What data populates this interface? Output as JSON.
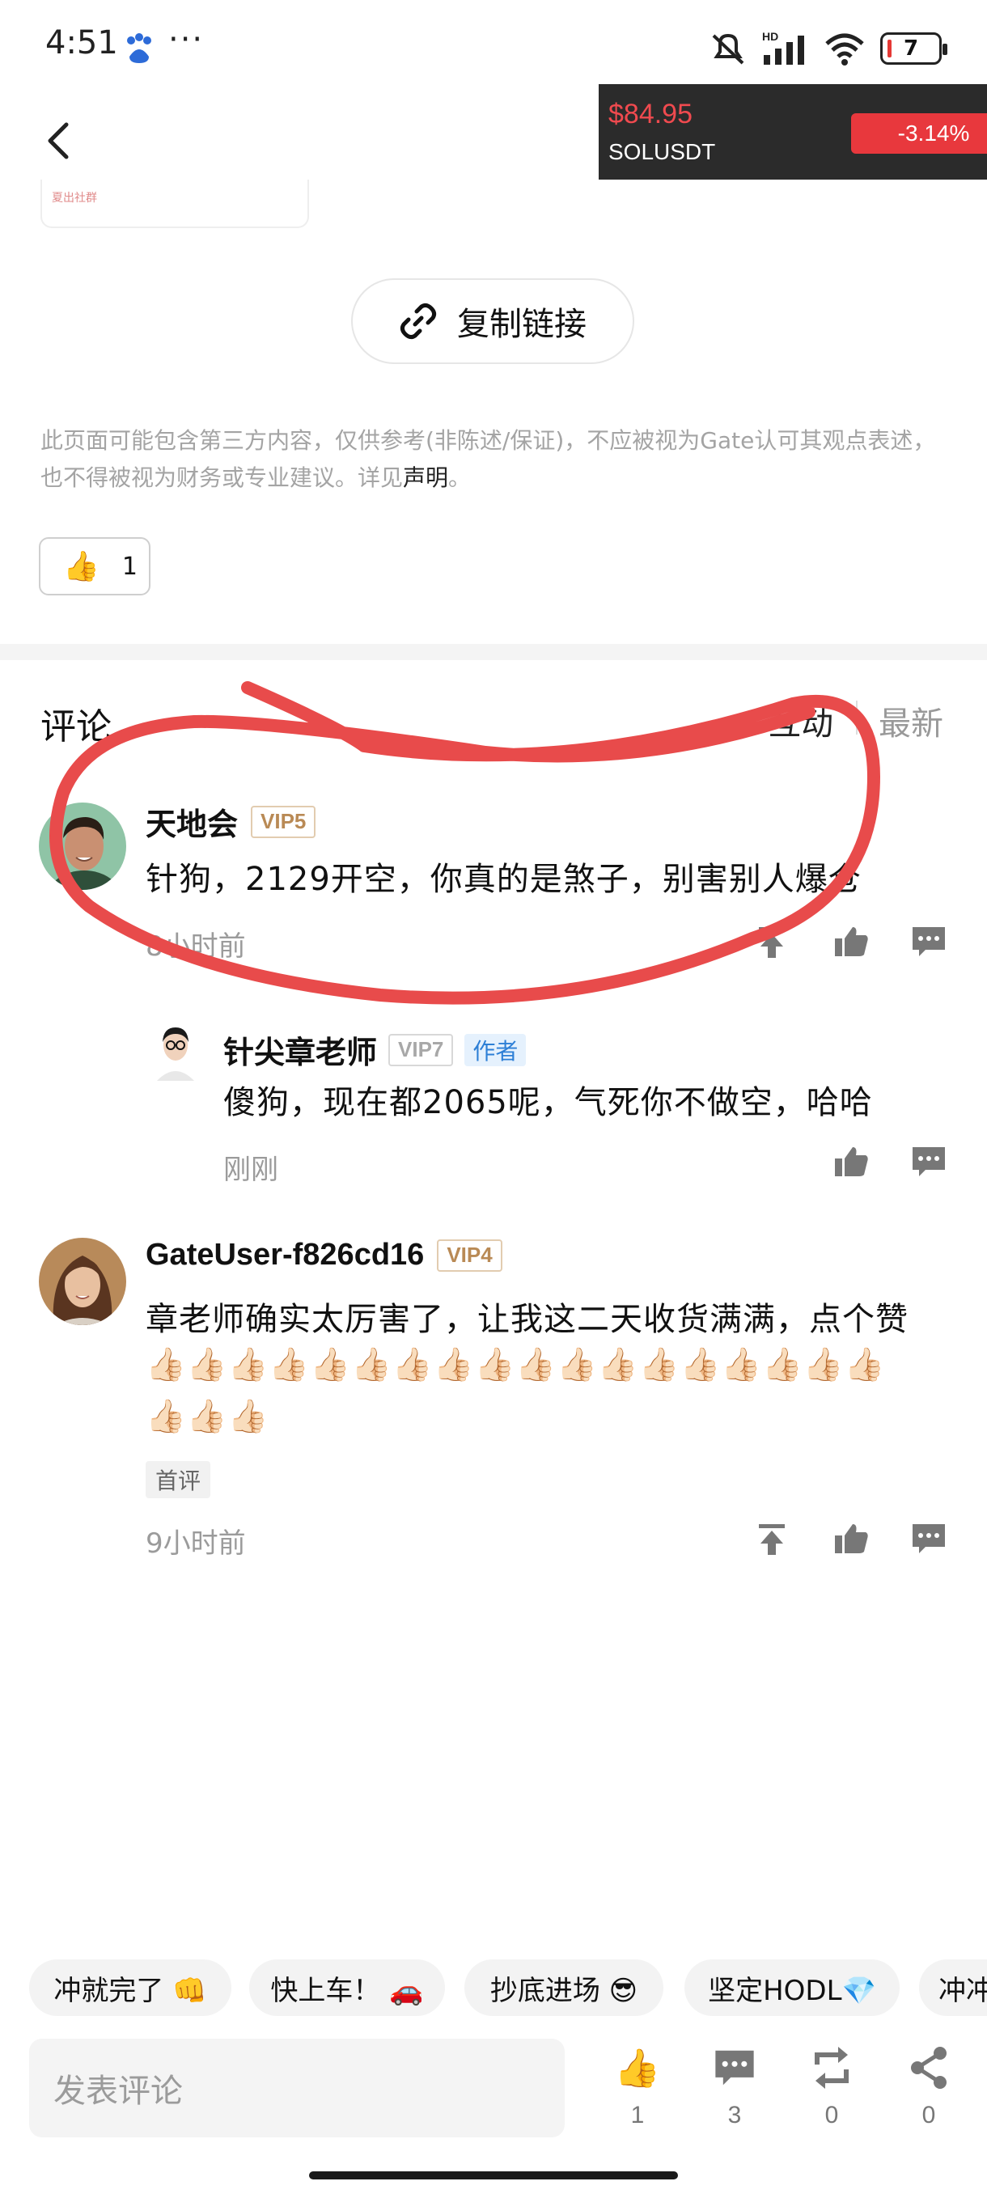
{
  "status_bar": {
    "time": "4:51",
    "more": "···",
    "battery": "7",
    "hd_label": "HD"
  },
  "ticker": {
    "price": "$84.95",
    "symbol": "SOLUSDT",
    "change": "-3.14%",
    "change_color": "#e8383d",
    "price_color": "#f04a4f"
  },
  "card_fragment": {
    "text": "夏出社群"
  },
  "copy_link": {
    "label": "复制链接",
    "icon": "link-icon"
  },
  "disclaimer": {
    "text": "此页面可能包含第三方内容，仅供参考(非陈述/保证)，不应被视为Gate认可其观点表述，也不得被视为财务或专业建议。详见",
    "link": "声明",
    "end": "。"
  },
  "post_like": {
    "icon": "thumbs-up-icon",
    "count": "1"
  },
  "comments": {
    "title": "评论",
    "sort_hot": "互动",
    "sort_new": "最新",
    "items": [
      {
        "user": "天地会",
        "vip": "VIP5",
        "text": "针狗，2129开空，你真的是煞子，别害别人爆仓",
        "time": "8小时前",
        "reply": {
          "user": "针尖章老师",
          "vip": "VIP7",
          "author_tag": "作者",
          "text": "傻狗，现在都2065呢，气死你不做空，哈哈",
          "time": "刚刚"
        }
      },
      {
        "user": "GateUser-f826cd16",
        "vip": "VIP4",
        "text": "章老师确实太厉害了，让我这二天收货满满，点个赞",
        "emojis_line1": "👍🏻👍🏻👍🏻👍🏻👍🏻👍🏻👍🏻👍🏻👍🏻👍🏻👍🏻👍🏻👍🏻👍🏻👍🏻👍🏻👍🏻👍🏻",
        "emojis_line2": "👍🏻👍🏻👍🏻",
        "tag": "首评",
        "time": "9小时前"
      }
    ]
  },
  "quick_replies": [
    "冲就完了 👊",
    "快上车！ 🚗",
    "抄底进场 😎",
    "坚定HODL💎",
    "冲冲"
  ],
  "input": {
    "placeholder": "发表评论"
  },
  "bottom_actions": {
    "like": {
      "icon": "thumbs-up-icon",
      "count": "1"
    },
    "comment": {
      "icon": "comment-icon",
      "count": "3"
    },
    "repost": {
      "icon": "repost-icon",
      "count": "0"
    },
    "share": {
      "icon": "share-icon",
      "count": "0"
    }
  },
  "annotation_color": "#e84b4b"
}
